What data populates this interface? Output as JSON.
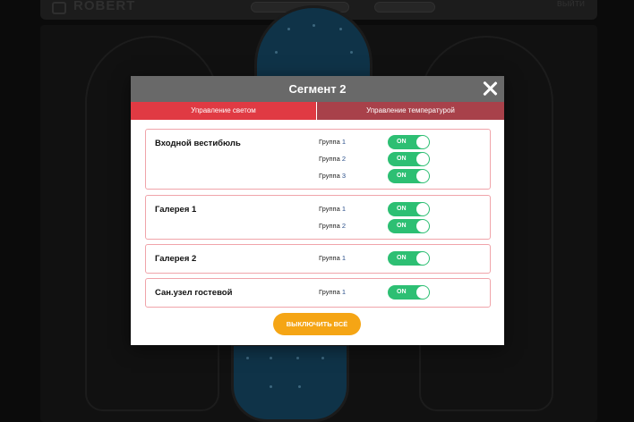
{
  "background": {
    "logo_text": "ROBERT",
    "exit_text": "выйти"
  },
  "modal": {
    "title": "Сегмент 2",
    "tabs": [
      {
        "label": "Управление светом",
        "active": true
      },
      {
        "label": "Управление температурой",
        "active": false
      }
    ],
    "zones": [
      {
        "name": "Входной вестибюль",
        "groups": [
          {
            "label": "Группа",
            "number": "1",
            "state": "ON"
          },
          {
            "label": "Группа",
            "number": "2",
            "state": "ON"
          },
          {
            "label": "Группа",
            "number": "3",
            "state": "ON"
          }
        ]
      },
      {
        "name": "Галерея 1",
        "groups": [
          {
            "label": "Группа",
            "number": "1",
            "state": "ON"
          },
          {
            "label": "Группа",
            "number": "2",
            "state": "ON"
          }
        ]
      },
      {
        "name": "Галерея 2",
        "groups": [
          {
            "label": "Группа",
            "number": "1",
            "state": "ON"
          }
        ]
      },
      {
        "name": "Сан.узел гостевой",
        "groups": [
          {
            "label": "Группа",
            "number": "1",
            "state": "ON"
          }
        ]
      }
    ],
    "turn_off_all_label": "ВЫКЛЮЧИТЬ ВСЁ"
  },
  "colors": {
    "header": "#696969",
    "tab_active": "#e03a43",
    "tab_inactive": "#a8414a",
    "toggle_on": "#2dbf73",
    "button_orange": "#f5a515",
    "card_border": "#f0a4aa"
  }
}
